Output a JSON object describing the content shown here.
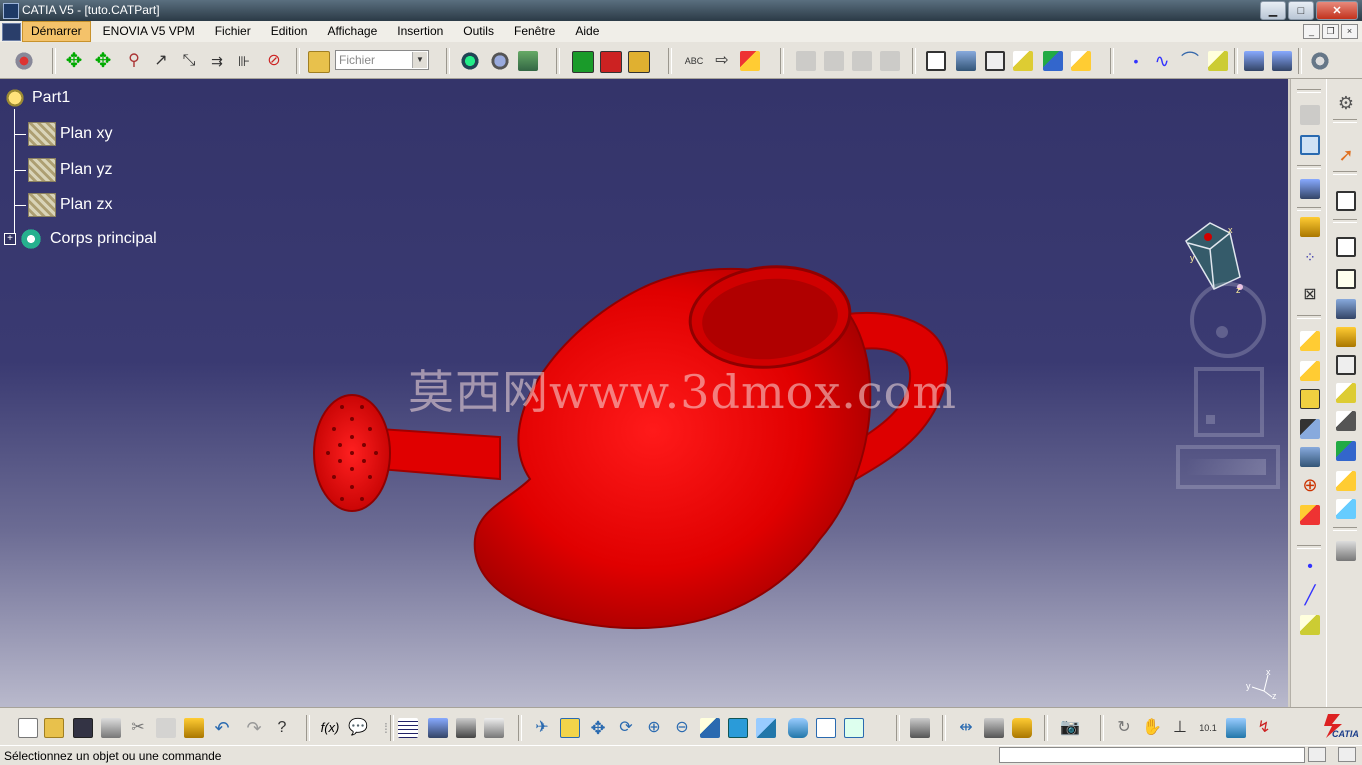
{
  "window": {
    "title": "CATIA V5 - [tuto.CATPart]",
    "minimize": "▁",
    "maximize": "□",
    "close": "✕"
  },
  "menubar": {
    "items": [
      {
        "label": "Démarrer",
        "active": true
      },
      {
        "label": "ENOVIA V5 VPM"
      },
      {
        "label": "Fichier"
      },
      {
        "label": "Edition"
      },
      {
        "label": "Affichage"
      },
      {
        "label": "Insertion"
      },
      {
        "label": "Outils"
      },
      {
        "label": "Fenêtre"
      },
      {
        "label": "Aide"
      }
    ],
    "mdi_min": "_",
    "mdi_restore": "❐",
    "mdi_close": "×"
  },
  "toolbar": {
    "combo_value": "Fichier",
    "combo_arrow": "▼"
  },
  "tree": {
    "root": "Part1",
    "planes": [
      "Plan xy",
      "Plan yz",
      "Plan zx"
    ],
    "body": "Corps principal",
    "expand": "+"
  },
  "viewport": {
    "watermark": "莫西网www.3dmox.com",
    "compass_x": "x",
    "compass_y": "y",
    "compass_z": "z",
    "axis_x": "x",
    "axis_y": "y",
    "axis_z": "z",
    "model_color": "#e60000"
  },
  "status": {
    "message": "Sélectionnez un objet ou une commande"
  },
  "logo": {
    "text": "CATIA"
  }
}
